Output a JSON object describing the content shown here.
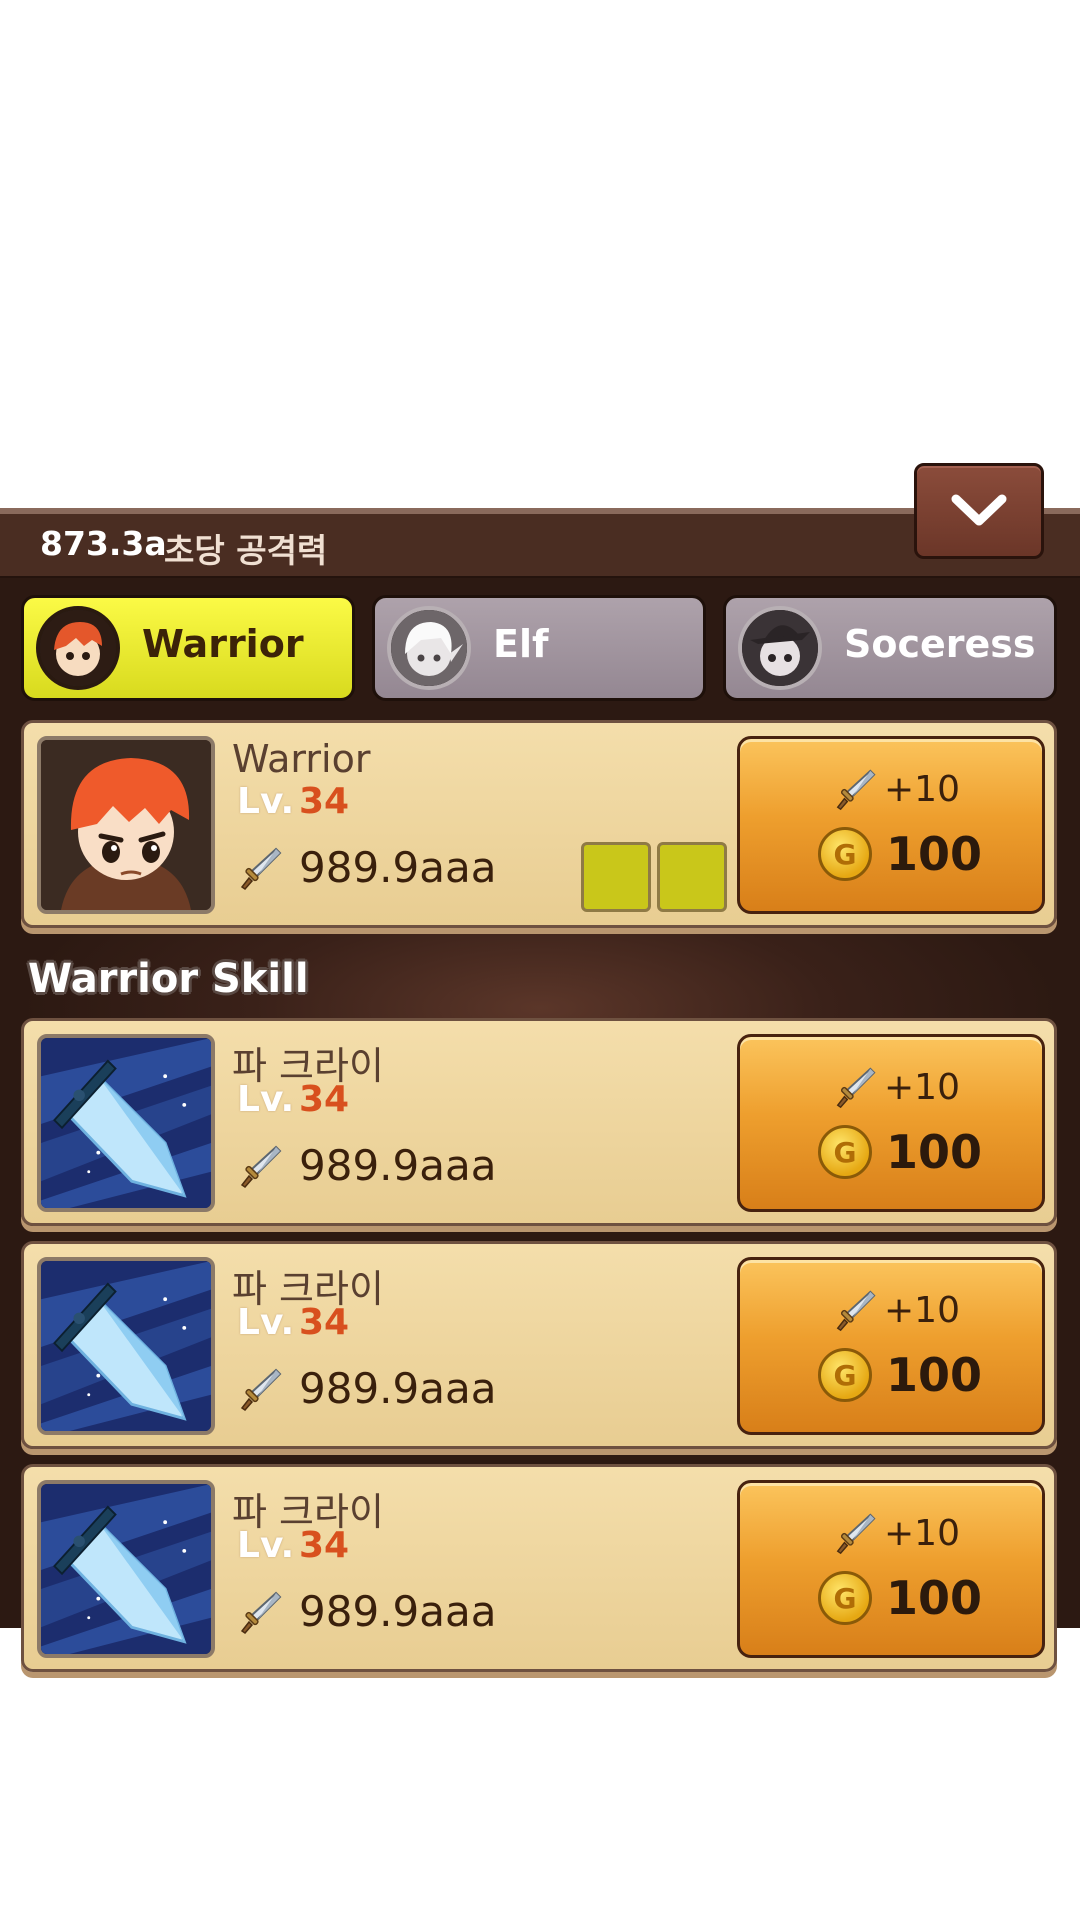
{
  "header": {
    "dps_value": "873.3a",
    "dps_label": "초당 공격력",
    "collapse_icon": "chevron-down-icon"
  },
  "tabs": [
    {
      "label": "Warrior",
      "active": true
    },
    {
      "label": "Elf",
      "active": false
    },
    {
      "label": "Soceress",
      "active": false
    }
  ],
  "hero": {
    "name": "Warrior",
    "lv_label": "Lv.",
    "level": "34",
    "power": "989.9aaa",
    "upgrade": {
      "bonus": "+10",
      "cost": "100"
    }
  },
  "section_title": "Warrior Skill",
  "skills": [
    {
      "name": "파 크라이",
      "lv_label": "Lv.",
      "level": "34",
      "power": "989.9aaa",
      "upgrade": {
        "bonus": "+10",
        "cost": "100"
      }
    },
    {
      "name": "파 크라이",
      "lv_label": "Lv.",
      "level": "34",
      "power": "989.9aaa",
      "upgrade": {
        "bonus": "+10",
        "cost": "100"
      }
    },
    {
      "name": "파 크라이",
      "lv_label": "Lv.",
      "level": "34",
      "power": "989.9aaa",
      "upgrade": {
        "bonus": "+10",
        "cost": "100"
      }
    }
  ],
  "coin_glyph": "G",
  "colors": {
    "tab_active": "#f1f136",
    "tab_inactive": "#a79ba5",
    "level_value": "#d8501e",
    "upgrade_button": "#ee9f2e",
    "panel_bg": "#3a2119"
  }
}
